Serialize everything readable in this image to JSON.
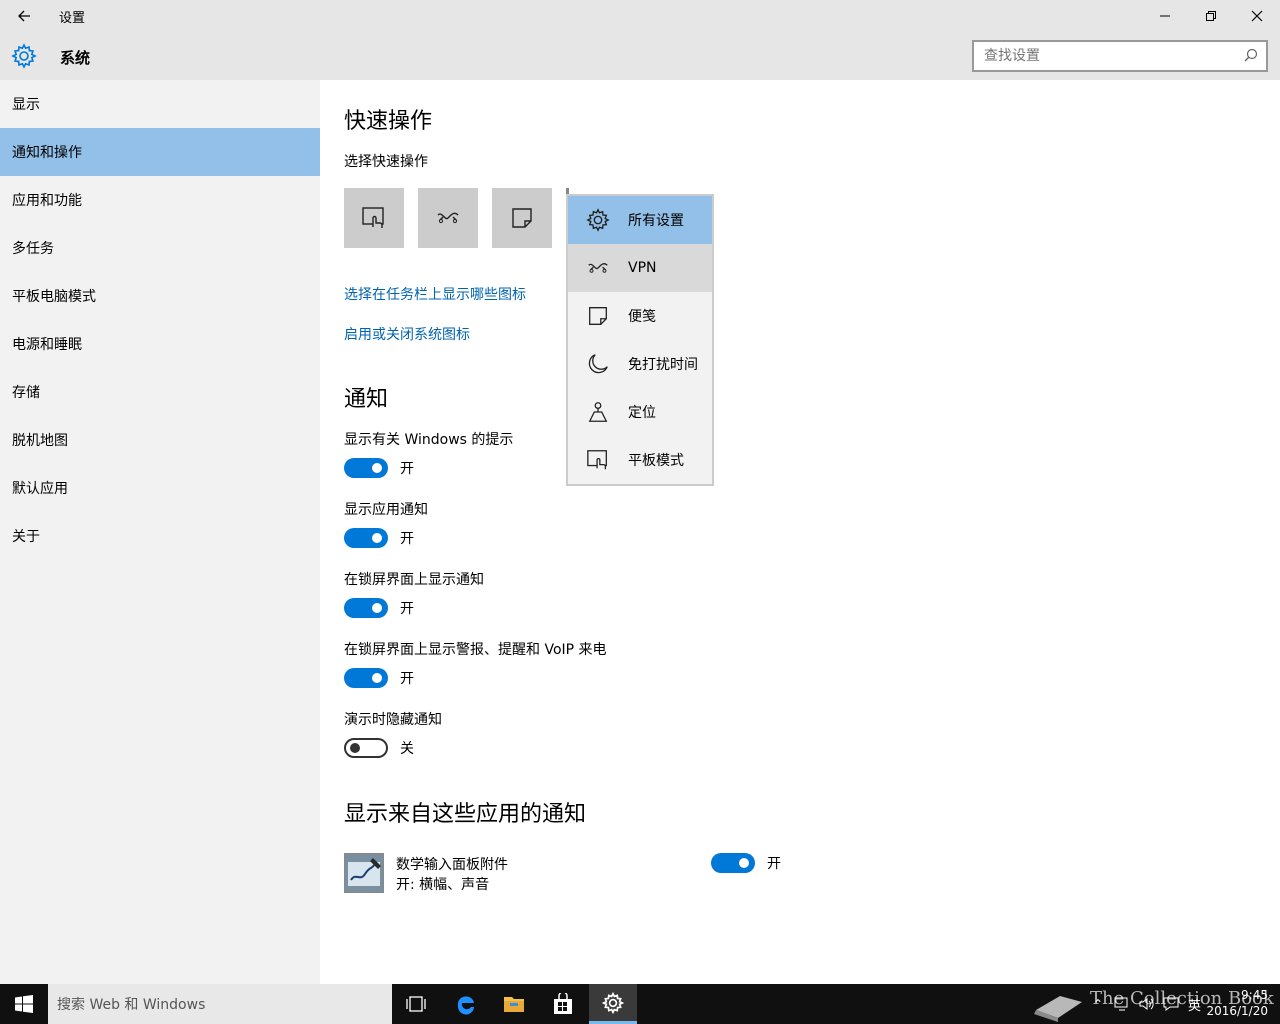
{
  "window": {
    "title": "设置"
  },
  "header": {
    "section": "系统",
    "search_placeholder": "查找设置"
  },
  "sidebar": {
    "items": [
      {
        "label": "显示"
      },
      {
        "label": "通知和操作",
        "active": true
      },
      {
        "label": "应用和功能"
      },
      {
        "label": "多任务"
      },
      {
        "label": "平板电脑模式"
      },
      {
        "label": "电源和睡眠"
      },
      {
        "label": "存储"
      },
      {
        "label": "脱机地图"
      },
      {
        "label": "默认应用"
      },
      {
        "label": "关于"
      }
    ]
  },
  "quick_actions": {
    "heading": "快速操作",
    "subheading": "选择快速操作",
    "buttons": [
      "tablet-mode-icon",
      "vpn-icon",
      "note-icon"
    ],
    "link_taskbar_icons": "选择在任务栏上显示哪些图标",
    "link_system_icons": "启用或关闭系统图标"
  },
  "dropdown": {
    "items": [
      {
        "label": "所有设置",
        "icon": "gear-icon",
        "state": "selected"
      },
      {
        "label": "VPN",
        "icon": "vpn-icon",
        "state": "hover"
      },
      {
        "label": "便笺",
        "icon": "note-icon"
      },
      {
        "label": "免打扰时间",
        "icon": "moon-icon"
      },
      {
        "label": "定位",
        "icon": "location-icon"
      },
      {
        "label": "平板模式",
        "icon": "tablet-mode-icon"
      }
    ]
  },
  "notifications": {
    "heading": "通知",
    "settings": [
      {
        "label": "显示有关 Windows 的提示",
        "state": "开",
        "on": true
      },
      {
        "label": "显示应用通知",
        "state": "开",
        "on": true
      },
      {
        "label": "在锁屏界面上显示通知",
        "state": "开",
        "on": true
      },
      {
        "label": "在锁屏界面上显示警报、提醒和 VoIP 来电",
        "state": "开",
        "on": true
      },
      {
        "label": "演示时隐藏通知",
        "state": "关",
        "on": false
      }
    ]
  },
  "apps": {
    "heading": "显示来自这些应用的通知",
    "items": [
      {
        "name": "数学输入面板附件",
        "detail": "开: 横幅、声音",
        "state": "开",
        "on": true
      }
    ]
  },
  "taskbar": {
    "search_placeholder": "搜索 Web 和 Windows",
    "ime": "英",
    "time": "9:45",
    "date": "2016/1/20",
    "watermark": "The Collection Book"
  },
  "colors": {
    "accent": "#0078d7",
    "selection": "#92c0e8",
    "link": "#0063b1"
  }
}
